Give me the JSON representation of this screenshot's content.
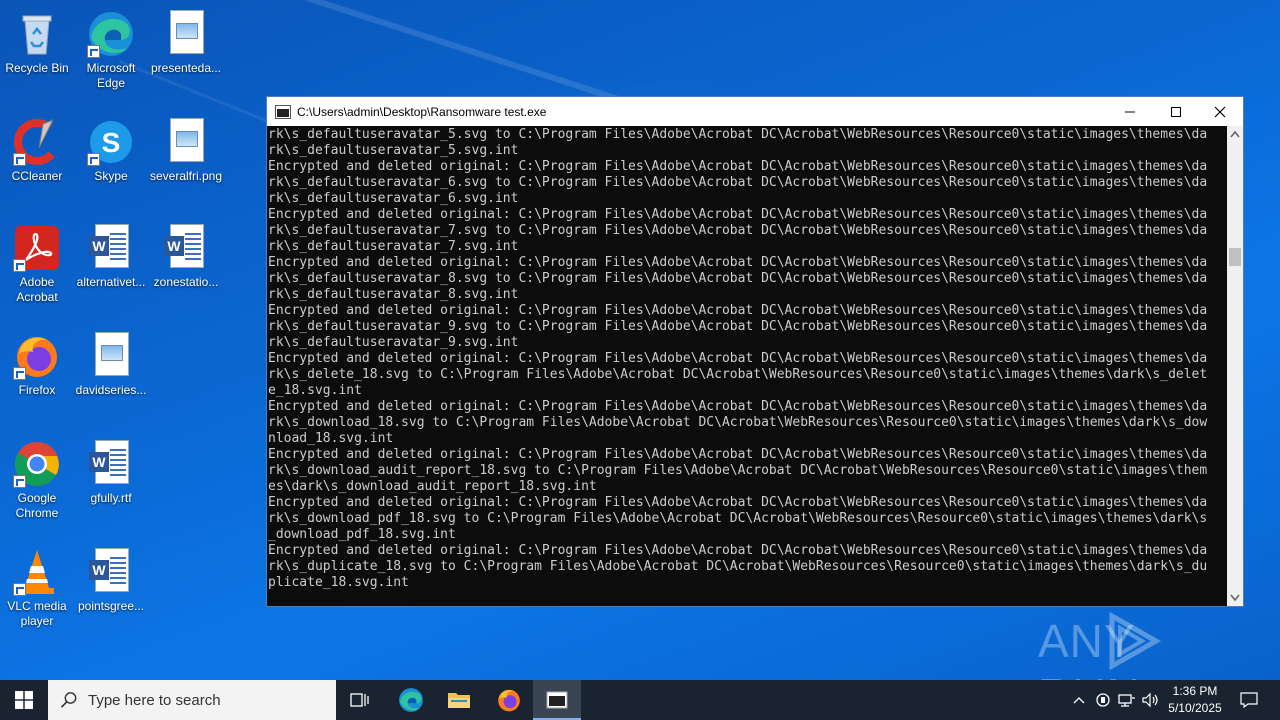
{
  "desktop_icons": [
    {
      "label": "Recycle Bin"
    },
    {
      "label": "Microsoft Edge"
    },
    {
      "label": "presenteda..."
    },
    {
      "label": "CCleaner"
    },
    {
      "label": "Skype"
    },
    {
      "label": "severalfri.png"
    },
    {
      "label": "Adobe Acrobat"
    },
    {
      "label": "alternativet..."
    },
    {
      "label": "zonestatio..."
    },
    {
      "label": "Firefox"
    },
    {
      "label": "davidseries..."
    },
    {
      "label": "Google Chrome"
    },
    {
      "label": "gfully.rtf"
    },
    {
      "label": "VLC media player"
    },
    {
      "label": "pointsgree..."
    }
  ],
  "console": {
    "title": "C:\\Users\\admin\\Desktop\\Ransomware test.exe",
    "lines": [
      "rk\\s_defaultuseravatar_5.svg to C:\\Program Files\\Adobe\\Acrobat DC\\Acrobat\\WebResources\\Resource0\\static\\images\\themes\\da",
      "rk\\s_defaultuseravatar_5.svg.int",
      "Encrypted and deleted original: C:\\Program Files\\Adobe\\Acrobat DC\\Acrobat\\WebResources\\Resource0\\static\\images\\themes\\da",
      "rk\\s_defaultuseravatar_6.svg to C:\\Program Files\\Adobe\\Acrobat DC\\Acrobat\\WebResources\\Resource0\\static\\images\\themes\\da",
      "rk\\s_defaultuseravatar_6.svg.int",
      "Encrypted and deleted original: C:\\Program Files\\Adobe\\Acrobat DC\\Acrobat\\WebResources\\Resource0\\static\\images\\themes\\da",
      "rk\\s_defaultuseravatar_7.svg to C:\\Program Files\\Adobe\\Acrobat DC\\Acrobat\\WebResources\\Resource0\\static\\images\\themes\\da",
      "rk\\s_defaultuseravatar_7.svg.int",
      "Encrypted and deleted original: C:\\Program Files\\Adobe\\Acrobat DC\\Acrobat\\WebResources\\Resource0\\static\\images\\themes\\da",
      "rk\\s_defaultuseravatar_8.svg to C:\\Program Files\\Adobe\\Acrobat DC\\Acrobat\\WebResources\\Resource0\\static\\images\\themes\\da",
      "rk\\s_defaultuseravatar_8.svg.int",
      "Encrypted and deleted original: C:\\Program Files\\Adobe\\Acrobat DC\\Acrobat\\WebResources\\Resource0\\static\\images\\themes\\da",
      "rk\\s_defaultuseravatar_9.svg to C:\\Program Files\\Adobe\\Acrobat DC\\Acrobat\\WebResources\\Resource0\\static\\images\\themes\\da",
      "rk\\s_defaultuseravatar_9.svg.int",
      "Encrypted and deleted original: C:\\Program Files\\Adobe\\Acrobat DC\\Acrobat\\WebResources\\Resource0\\static\\images\\themes\\da",
      "rk\\s_delete_18.svg to C:\\Program Files\\Adobe\\Acrobat DC\\Acrobat\\WebResources\\Resource0\\static\\images\\themes\\dark\\s_delet",
      "e_18.svg.int",
      "Encrypted and deleted original: C:\\Program Files\\Adobe\\Acrobat DC\\Acrobat\\WebResources\\Resource0\\static\\images\\themes\\da",
      "rk\\s_download_18.svg to C:\\Program Files\\Adobe\\Acrobat DC\\Acrobat\\WebResources\\Resource0\\static\\images\\themes\\dark\\s_dow",
      "nload_18.svg.int",
      "Encrypted and deleted original: C:\\Program Files\\Adobe\\Acrobat DC\\Acrobat\\WebResources\\Resource0\\static\\images\\themes\\da",
      "rk\\s_download_audit_report_18.svg to C:\\Program Files\\Adobe\\Acrobat DC\\Acrobat\\WebResources\\Resource0\\static\\images\\them",
      "es\\dark\\s_download_audit_report_18.svg.int",
      "Encrypted and deleted original: C:\\Program Files\\Adobe\\Acrobat DC\\Acrobat\\WebResources\\Resource0\\static\\images\\themes\\da",
      "rk\\s_download_pdf_18.svg to C:\\Program Files\\Adobe\\Acrobat DC\\Acrobat\\WebResources\\Resource0\\static\\images\\themes\\dark\\s",
      "_download_pdf_18.svg.int",
      "Encrypted and deleted original: C:\\Program Files\\Adobe\\Acrobat DC\\Acrobat\\WebResources\\Resource0\\static\\images\\themes\\da",
      "rk\\s_duplicate_18.svg to C:\\Program Files\\Adobe\\Acrobat DC\\Acrobat\\WebResources\\Resource0\\static\\images\\themes\\dark\\s_du",
      "plicate_18.svg.int"
    ]
  },
  "watermark": {
    "text": "ANY RUN"
  },
  "taskbar": {
    "search_placeholder": "Type here to search",
    "time": "1:36 PM",
    "date": "5/10/2025"
  },
  "colors": {
    "taskbar_bg": "#1a2330",
    "console_bg": "#0c0c0c",
    "console_text": "#cccccc",
    "desktop_blue": "#0b6ad6"
  }
}
